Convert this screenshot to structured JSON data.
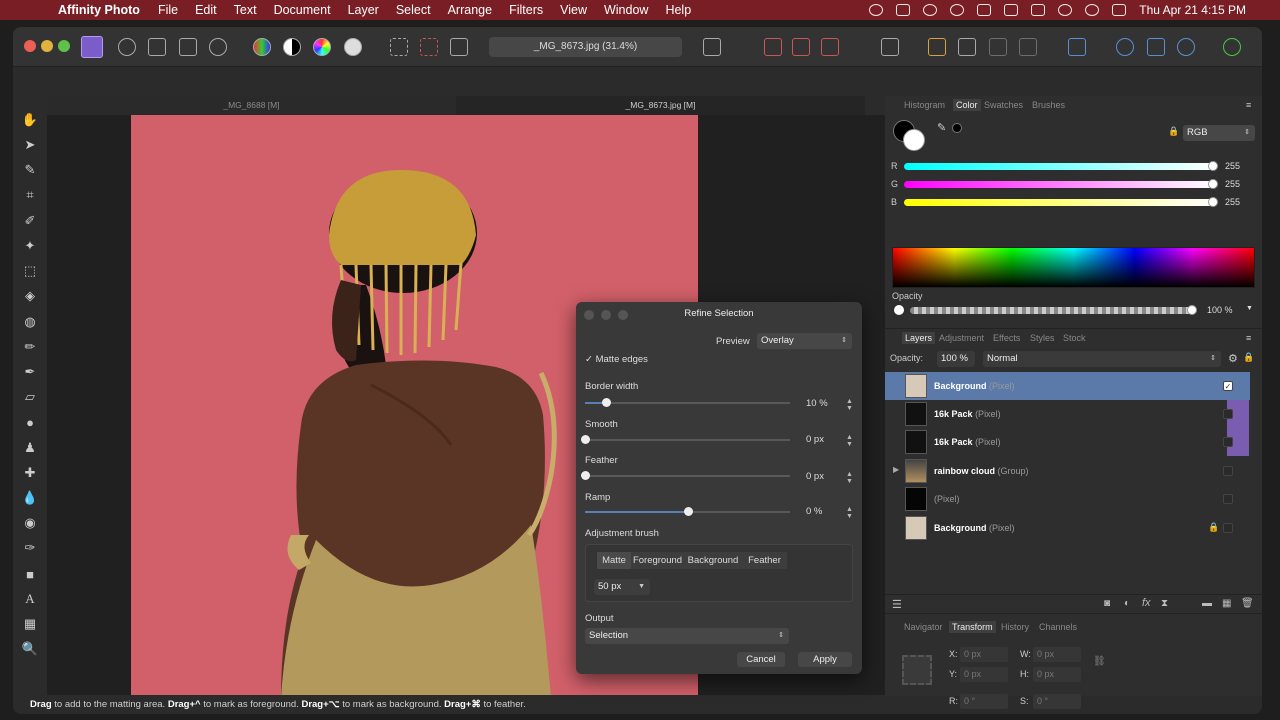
{
  "menubar": {
    "app_name": "Affinity Photo",
    "items": [
      "File",
      "Edit",
      "Text",
      "Document",
      "Layer",
      "Select",
      "Arrange",
      "Filters",
      "View",
      "Window",
      "Help"
    ],
    "clock": "Thu Apr 21  4:15 PM"
  },
  "toolbar": {
    "document_title": "_MG_8673.jpg (31.4%)"
  },
  "doc_tabs": [
    "_MG_8688 [M]",
    "_MG_8673.jpg [M]"
  ],
  "refine": {
    "title": "Refine Selection",
    "preview_label": "Preview",
    "preview_value": "Overlay",
    "matte_edges": "✓ Matte edges",
    "border_width": {
      "label": "Border width",
      "value": "10 %",
      "level": 0.1
    },
    "smooth": {
      "label": "Smooth",
      "value": "0 px",
      "level": 0
    },
    "feather": {
      "label": "Feather",
      "value": "0 px",
      "level": 0
    },
    "ramp": {
      "label": "Ramp",
      "value": "0 %",
      "level": 0.5
    },
    "brush_label": "Adjustment brush",
    "brush_modes": [
      "Matte",
      "Foreground",
      "Background",
      "Feather"
    ],
    "brush_size": "50 px",
    "output_label": "Output",
    "output_value": "Selection",
    "cancel": "Cancel",
    "apply": "Apply"
  },
  "color_panel": {
    "tabs": [
      "Histogram",
      "Color",
      "Swatches",
      "Brushes"
    ],
    "mode": "RGB",
    "r_label": "R",
    "r_value": "255",
    "g_label": "G",
    "g_value": "255",
    "b_label": "B",
    "b_value": "255",
    "opacity_label": "Opacity",
    "opacity_value": "100 %"
  },
  "layers_panel": {
    "tabs": [
      "Layers",
      "Adjustment",
      "Effects",
      "Styles",
      "Stock"
    ],
    "opacity_label": "Opacity:",
    "opacity_value": "100 %",
    "blend_mode": "Normal",
    "layers": [
      {
        "name": "Background",
        "type": "(Pixel)"
      },
      {
        "name": "16k Pack",
        "type": "(Pixel)"
      },
      {
        "name": "16k Pack",
        "type": "(Pixel)"
      },
      {
        "name": "rainbow cloud",
        "type": "(Group)"
      },
      {
        "name": "",
        "type": "(Pixel)"
      },
      {
        "name": "Background",
        "type": "(Pixel)"
      }
    ]
  },
  "transform_panel": {
    "tabs": [
      "Navigator",
      "Transform",
      "History",
      "Channels"
    ],
    "x_label": "X:",
    "x_value": "0 px",
    "y_label": "Y:",
    "y_value": "0 px",
    "w_label": "W:",
    "w_value": "0 px",
    "h_label": "H:",
    "h_value": "0 px",
    "r_label": "R:",
    "r_value": "0 °",
    "s_label": "S:",
    "s_value": "0 °"
  },
  "status": {
    "drag1": "Drag",
    "t1": " to add to the matting area. ",
    "drag2": "Drag+^",
    "t2": " to mark as foreground. ",
    "drag3": "Drag+⌥",
    "t3": " to mark as background. ",
    "drag4": "Drag+⌘",
    "t4": " to feather."
  },
  "colors": {
    "menubar": "#7a1e26",
    "backdrop": "#d2606a",
    "selection": "#5b7aa9",
    "accent": "#5a7fb5"
  }
}
